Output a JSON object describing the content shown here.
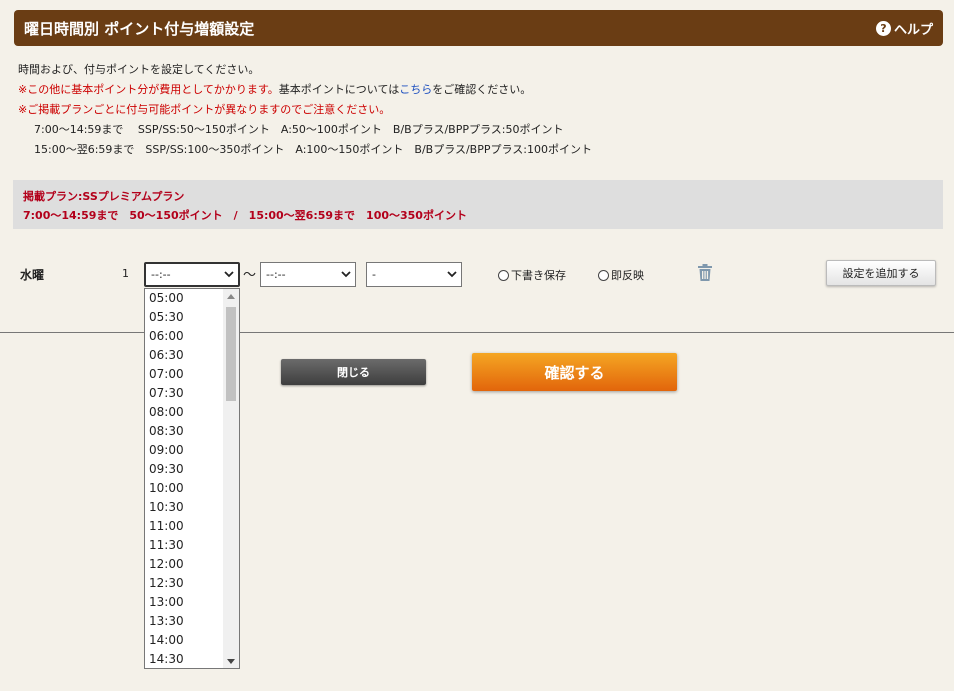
{
  "header": {
    "title": "曜日時間別 ポイント付与増額設定",
    "help_label": "ヘルプ",
    "help_icon": "question-icon"
  },
  "info": {
    "line1": "時間および、付与ポイントを設定してください。",
    "line2_red": "※この他に基本ポイント分が費用としてかかります。",
    "line2_a": "基本ポイントについては",
    "line2_link": "こちら",
    "line2_b": "をご確認ください。",
    "line3": "※ご掲載プランごとに付与可能ポイントが異なりますのでご注意ください。",
    "line4": "7:00〜14:59まで　 SSP/SS:50〜150ポイント　A:50〜100ポイント　B/Bプラス/BPPプラス:50ポイント",
    "line5": "15:00〜翌6:59まで　SSP/SS:100〜350ポイント　A:100〜150ポイント　B/Bプラス/BPPプラス:100ポイント"
  },
  "plan": {
    "line1": "掲載プラン:SSプレミアムプラン",
    "line2": "7:00〜14:59まで　50〜150ポイント　/　15:00〜翌6:59まで　100〜350ポイント"
  },
  "row": {
    "day": "水曜",
    "index": "1",
    "start_value": "--:--",
    "tilde": "〜",
    "end_value": "--:--",
    "points_value": "-",
    "radio_draft": "下書き保存",
    "radio_immediate": "即反映",
    "add_label": "設定を追加する"
  },
  "buttons": {
    "close": "閉じる",
    "confirm": "確認する"
  },
  "dropdown": {
    "options": [
      "05:00",
      "05:30",
      "06:00",
      "06:30",
      "07:00",
      "07:30",
      "08:00",
      "08:30",
      "09:00",
      "09:30",
      "10:00",
      "10:30",
      "11:00",
      "11:30",
      "12:00",
      "12:30",
      "13:00",
      "13:30",
      "14:00",
      "14:30"
    ]
  },
  "colors": {
    "header_bg": "#6a3d14",
    "accent_red": "#c00000",
    "confirm_orange": "#e8760f",
    "link_blue": "#1a4dbf"
  }
}
